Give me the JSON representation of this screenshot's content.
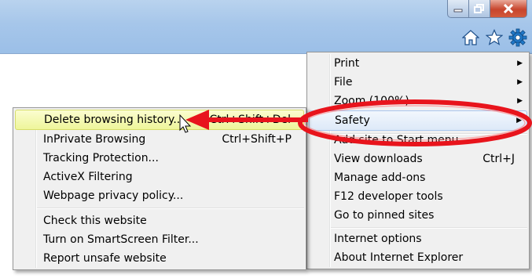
{
  "window": {
    "caption_icons": [
      "minimize-icon",
      "restore-icon",
      "close-icon"
    ],
    "toolbar_icons": [
      "home-icon",
      "favorites-star-icon",
      "tools-gear-icon"
    ]
  },
  "tools_menu": {
    "items": [
      {
        "label": "Print",
        "submenu": true
      },
      {
        "label": "File",
        "submenu": true
      },
      {
        "label": "Zoom (100%)",
        "submenu": true
      },
      {
        "label": "Safety",
        "submenu": true,
        "highlighted": true
      },
      {
        "label": "Add site to Start menu"
      },
      {
        "label": "View downloads",
        "shortcut": "Ctrl+J"
      },
      {
        "label": "Manage add-ons"
      },
      {
        "label": "F12 developer tools"
      },
      {
        "label": "Go to pinned sites"
      },
      {
        "label": "Internet options"
      },
      {
        "label": "About Internet Explorer"
      }
    ]
  },
  "safety_menu": {
    "items": [
      {
        "label": "Delete browsing history...",
        "shortcut": "Ctrl+Shift+Del",
        "highlighted": true
      },
      {
        "label": "InPrivate Browsing",
        "shortcut": "Ctrl+Shift+P"
      },
      {
        "label": "Tracking Protection..."
      },
      {
        "label": "ActiveX Filtering"
      },
      {
        "label": "Webpage privacy policy..."
      },
      {
        "label": "Check this website"
      },
      {
        "label": "Turn on SmartScreen Filter..."
      },
      {
        "label": "Report unsafe website"
      }
    ]
  },
  "annotation_color": "#e8141c"
}
